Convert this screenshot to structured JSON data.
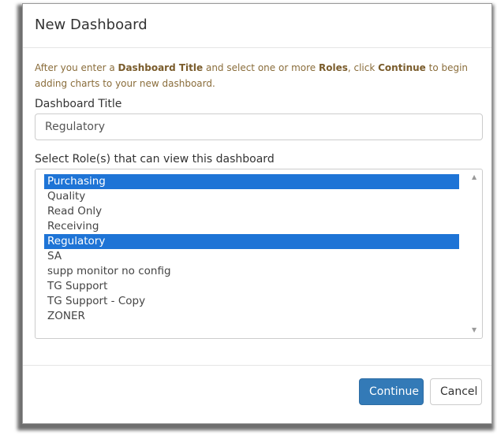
{
  "dialog": {
    "title": "New Dashboard"
  },
  "instructions": {
    "part1": "After you enter a ",
    "bold1": "Dashboard Title",
    "part2": " and select one or more ",
    "bold2": "Roles",
    "part3": ", click ",
    "bold3": "Continue",
    "part4": " to begin adding charts to your new dashboard."
  },
  "title_field": {
    "label": "Dashboard Title",
    "value": "Regulatory"
  },
  "roles_field": {
    "label": "Select Role(s) that can view this dashboard",
    "options": [
      {
        "label": "Purchasing",
        "selected": true
      },
      {
        "label": "Quality",
        "selected": false
      },
      {
        "label": "Read Only",
        "selected": false
      },
      {
        "label": "Receiving",
        "selected": false
      },
      {
        "label": "Regulatory",
        "selected": true
      },
      {
        "label": "SA",
        "selected": false
      },
      {
        "label": "supp monitor no config",
        "selected": false
      },
      {
        "label": "TG Support",
        "selected": false
      },
      {
        "label": "TG Support - Copy",
        "selected": false
      },
      {
        "label": "ZONER",
        "selected": false
      }
    ]
  },
  "footer": {
    "continue_label": "Continue",
    "cancel_label": "Cancel"
  },
  "colors": {
    "selection": "#1e74d6",
    "primary_button": "#337ab7",
    "instructions_text": "#8a6d3b"
  },
  "icons": {
    "scroll_up": "scroll-up-arrow-icon",
    "scroll_down": "scroll-down-arrow-icon"
  }
}
